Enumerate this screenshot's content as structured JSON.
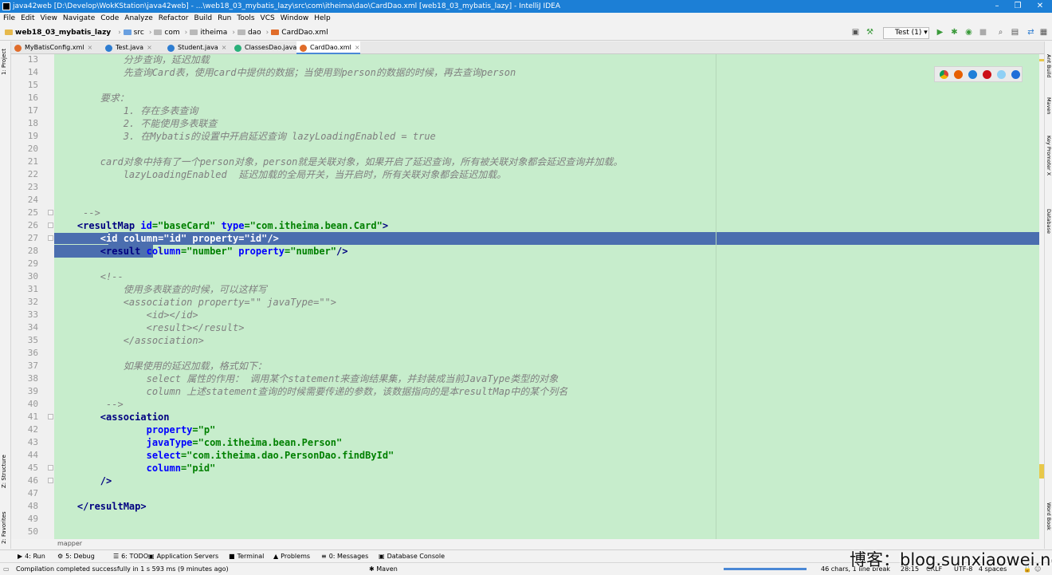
{
  "window": {
    "title": "java42web [D:\\Develop\\WokKStation\\java42web] - ...\\web18_03_mybatis_lazy\\src\\com\\itheima\\dao\\CardDao.xml [web18_03_mybatis_lazy] - IntelliJ IDEA",
    "minimize": "–",
    "maximize": "❐",
    "close": "✕"
  },
  "menu": [
    "File",
    "Edit",
    "View",
    "Navigate",
    "Code",
    "Analyze",
    "Refactor",
    "Build",
    "Run",
    "Tools",
    "VCS",
    "Window",
    "Help"
  ],
  "nav": {
    "project": "web18_03_mybatis_lazy",
    "crumbs": [
      "src",
      "com",
      "itheima",
      "dao",
      "CardDao.xml"
    ],
    "run_config": "Test (1)"
  },
  "tabs": [
    {
      "label": "MyBatisConfig.xml",
      "icon_color": "#e06c2a"
    },
    {
      "label": "Test.java",
      "icon_color": "#2e7dd1"
    },
    {
      "label": "Student.java",
      "icon_color": "#2e7dd1"
    },
    {
      "label": "ClassesDao.java",
      "icon_color": "#2ab07a"
    },
    {
      "label": "CardDao.xml",
      "icon_color": "#e06c2a"
    }
  ],
  "left_tools": {
    "project": "1: Project",
    "structure": "Z: Structure",
    "favorites": "2: Favorites"
  },
  "right_tools": {
    "ant": "Ant Build",
    "maven": "Maven",
    "key": "Key Promoter X",
    "db": "Database",
    "wb": "Word Book"
  },
  "editor": {
    "line_numbers": [
      "13",
      "14",
      "15",
      "16",
      "17",
      "18",
      "19",
      "20",
      "21",
      "22",
      "23",
      "24",
      "25",
      "26",
      "27",
      "28",
      "29",
      "30",
      "31",
      "32",
      "33",
      "34",
      "35",
      "36",
      "37",
      "38",
      "39",
      "40",
      "41",
      "42",
      "43",
      "44",
      "45",
      "46",
      "47",
      "48",
      "49",
      "50"
    ],
    "lines": [
      [
        {
          "t": "            分步查询，延迟加载",
          "c": "cm"
        }
      ],
      [
        {
          "t": "            先查询Card表，使用card中提供的数据；当使用到person的数据的时候，再去查询person",
          "c": "cm"
        }
      ],
      [],
      [
        {
          "t": "        要求：",
          "c": "cm"
        }
      ],
      [
        {
          "t": "            1. 存在多表查询",
          "c": "cm"
        }
      ],
      [
        {
          "t": "            2. 不能使用多表联查",
          "c": "cm"
        }
      ],
      [
        {
          "t": "            3. 在Mybatis的设置中开启延迟查询 lazyLoadingEnabled = true",
          "c": "cm"
        }
      ],
      [],
      [
        {
          "t": "        card对象中持有了一个person对象，person就是关联对象，如果开启了延迟查询，所有被关联对象都会延迟查询并加载。",
          "c": "cm"
        }
      ],
      [
        {
          "t": "            lazyLoadingEnabled  延迟加载的全局开关，当开启时，所有关联对象都会延迟加载。",
          "c": "cm"
        }
      ],
      [],
      [],
      [
        {
          "t": "     -->",
          "c": "cm"
        }
      ],
      [
        {
          "t": "    <resultMap ",
          "c": "tg"
        },
        {
          "t": "id",
          "c": "an"
        },
        {
          "t": "=\"baseCard\" ",
          "c": "av"
        },
        {
          "t": "type",
          "c": "an"
        },
        {
          "t": "=\"com.itheima.bean.Card\"",
          "c": "av"
        },
        {
          "t": ">",
          "c": "tg"
        }
      ],
      [
        {
          "t": "        <id ",
          "c": "tg"
        },
        {
          "t": "column",
          "c": "an"
        },
        {
          "t": "=\"id\" ",
          "c": "av"
        },
        {
          "t": "property",
          "c": "an"
        },
        {
          "t": "=\"id\"",
          "c": "av"
        },
        {
          "t": "/>",
          "c": "tg"
        }
      ],
      [
        {
          "t": "        <result ",
          "c": "tg"
        },
        {
          "t": "column",
          "c": "an"
        },
        {
          "t": "=\"number\" ",
          "c": "av"
        },
        {
          "t": "property",
          "c": "an"
        },
        {
          "t": "=\"number\"",
          "c": "av"
        },
        {
          "t": "/>",
          "c": "tg"
        }
      ],
      [],
      [
        {
          "t": "        <!--",
          "c": "cm"
        }
      ],
      [
        {
          "t": "            使用多表联查的时候，可以这样写",
          "c": "cm"
        }
      ],
      [
        {
          "t": "            <association property=\"\" javaType=\"\">",
          "c": "cm"
        }
      ],
      [
        {
          "t": "                <id></id>",
          "c": "cm"
        }
      ],
      [
        {
          "t": "                <result></result>",
          "c": "cm"
        }
      ],
      [
        {
          "t": "            </association>",
          "c": "cm"
        }
      ],
      [],
      [
        {
          "t": "            如果使用的延迟加载，格式如下：",
          "c": "cm"
        }
      ],
      [
        {
          "t": "                select 属性的作用： 调用某个statement来查询结果集，并封装成当前JavaType类型的对象",
          "c": "cm"
        }
      ],
      [
        {
          "t": "                column 上述statement查询的时候需要传递的参数，该数据指向的是本resultMap中的某个列名",
          "c": "cm"
        }
      ],
      [
        {
          "t": "         -->",
          "c": "cm"
        }
      ],
      [
        {
          "t": "        <association",
          "c": "tg"
        }
      ],
      [
        {
          "t": "                ",
          "c": "pl"
        },
        {
          "t": "property",
          "c": "an"
        },
        {
          "t": "=\"p\"",
          "c": "av"
        }
      ],
      [
        {
          "t": "                ",
          "c": "pl"
        },
        {
          "t": "javaType",
          "c": "an"
        },
        {
          "t": "=\"com.itheima.bean.Person\"",
          "c": "av"
        }
      ],
      [
        {
          "t": "                ",
          "c": "pl"
        },
        {
          "t": "select",
          "c": "an"
        },
        {
          "t": "=\"com.itheima.dao.PersonDao.findById\"",
          "c": "av"
        }
      ],
      [
        {
          "t": "                ",
          "c": "pl"
        },
        {
          "t": "column",
          "c": "an"
        },
        {
          "t": "=\"pid\"",
          "c": "av"
        }
      ],
      [
        {
          "t": "        />",
          "c": "tg"
        }
      ],
      [],
      [
        {
          "t": "    </resultMap>",
          "c": "tg"
        }
      ],
      [],
      []
    ],
    "selected_lines": [
      14,
      15
    ]
  },
  "breadcrumb_path": "mapper",
  "bottom_tools": [
    {
      "label": "4: Run",
      "icon": "▶"
    },
    {
      "label": "5: Debug",
      "icon": "⚙"
    },
    {
      "label": "6: TODO",
      "icon": "☰"
    },
    {
      "label": "Application Servers",
      "icon": "▣"
    },
    {
      "label": "Terminal",
      "icon": "■"
    },
    {
      "label": "Problems",
      "icon": "▲"
    },
    {
      "label": "0: Messages",
      "icon": "≡"
    },
    {
      "label": "Database Console",
      "icon": "▣"
    }
  ],
  "status": {
    "message": "Compilation completed successfully in 1 s 593 ms (9 minutes ago)",
    "maven": "Maven",
    "chars": "46 chars, 1 line break",
    "position": "28:15",
    "line_sep": "CRLF",
    "encoding": "UTF-8",
    "indent": "4 spaces"
  },
  "watermark": "博客：blog.sunxiaowei.net"
}
